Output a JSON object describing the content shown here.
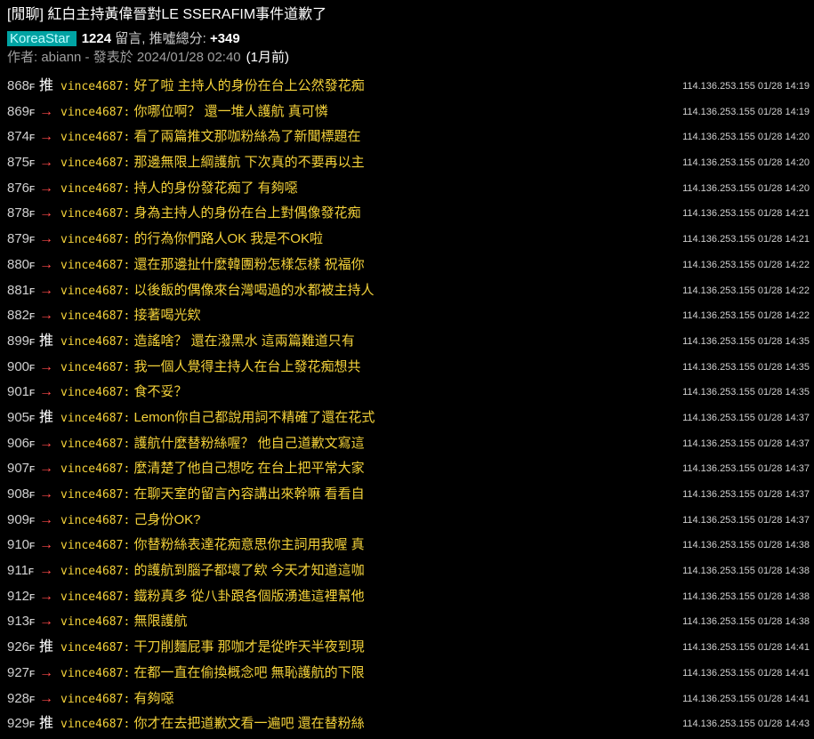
{
  "post": {
    "title": "[閒聊] 紅白主持黃偉晉對LE SSERAFIM事件道歉了",
    "board": " KoreaStar ",
    "comment_count": "1224",
    "comment_label": "留言, 推噓總分:",
    "score": "+349",
    "author_line": "作者: abiann - 發表於 2024/01/28 02:40",
    "ago": "(1月前)"
  },
  "colors": {
    "background": "#000000",
    "push_text": "#f4d23a",
    "arrow": "#ff4a4a",
    "board_tag_bg": "#00a3a3"
  },
  "comments": [
    {
      "floor": "868",
      "floor_suffix": "F",
      "tag": "推",
      "type": "push",
      "user": "vince4687",
      "text": "好了啦 主持人的身份在台上公然發花痴",
      "ipdate": "114.136.253.155 01/28 14:19"
    },
    {
      "floor": "869",
      "floor_suffix": "F",
      "tag": "→",
      "type": "arrow",
      "user": "vince4687",
      "text": "你哪位啊？ 還一堆人護航 真可憐",
      "ipdate": "114.136.253.155 01/28 14:19"
    },
    {
      "floor": "874",
      "floor_suffix": "F",
      "tag": "→",
      "type": "arrow",
      "user": "vince4687",
      "text": "看了兩篇推文那咖粉絲為了新聞標題在",
      "ipdate": "114.136.253.155 01/28 14:20"
    },
    {
      "floor": "875",
      "floor_suffix": "F",
      "tag": "→",
      "type": "arrow",
      "user": "vince4687",
      "text": "那邊無限上綱護航 下次真的不要再以主",
      "ipdate": "114.136.253.155 01/28 14:20"
    },
    {
      "floor": "876",
      "floor_suffix": "F",
      "tag": "→",
      "type": "arrow",
      "user": "vince4687",
      "text": "持人的身份發花痴了 有夠噁",
      "ipdate": "114.136.253.155 01/28 14:20"
    },
    {
      "floor": "878",
      "floor_suffix": "F",
      "tag": "→",
      "type": "arrow",
      "user": "vince4687",
      "text": "身為主持人的身份在台上對偶像發花痴",
      "ipdate": "114.136.253.155 01/28 14:21"
    },
    {
      "floor": "879",
      "floor_suffix": "F",
      "tag": "→",
      "type": "arrow",
      "user": "vince4687",
      "text": "的行為你們路人OK 我是不OK啦",
      "ipdate": "114.136.253.155 01/28 14:21"
    },
    {
      "floor": "880",
      "floor_suffix": "F",
      "tag": "→",
      "type": "arrow",
      "user": "vince4687",
      "text": "還在那邊扯什麼韓團粉怎樣怎樣 祝福你",
      "ipdate": "114.136.253.155 01/28 14:22"
    },
    {
      "floor": "881",
      "floor_suffix": "F",
      "tag": "→",
      "type": "arrow",
      "user": "vince4687",
      "text": "以後飯的偶像來台灣喝過的水都被主持人",
      "ipdate": "114.136.253.155 01/28 14:22"
    },
    {
      "floor": "882",
      "floor_suffix": "F",
      "tag": "→",
      "type": "arrow",
      "user": "vince4687",
      "text": "接著喝光欸",
      "ipdate": "114.136.253.155 01/28 14:22"
    },
    {
      "floor": "899",
      "floor_suffix": "F",
      "tag": "推",
      "type": "push",
      "user": "vince4687",
      "text": "造謠啥？ 還在潑黑水 這兩篇難道只有",
      "ipdate": "114.136.253.155 01/28 14:35"
    },
    {
      "floor": "900",
      "floor_suffix": "F",
      "tag": "→",
      "type": "arrow",
      "user": "vince4687",
      "text": "我一個人覺得主持人在台上發花痴想共",
      "ipdate": "114.136.253.155 01/28 14:35"
    },
    {
      "floor": "901",
      "floor_suffix": "F",
      "tag": "→",
      "type": "arrow",
      "user": "vince4687",
      "text": "食不妥？",
      "ipdate": "114.136.253.155 01/28 14:35"
    },
    {
      "floor": "905",
      "floor_suffix": "F",
      "tag": "推",
      "type": "push",
      "user": "vince4687",
      "text": "Lemon你自己都說用詞不精確了還在花式",
      "ipdate": "114.136.253.155 01/28 14:37"
    },
    {
      "floor": "906",
      "floor_suffix": "F",
      "tag": "→",
      "type": "arrow",
      "user": "vince4687",
      "text": "護航什麼替粉絲喔？ 他自己道歉文寫這",
      "ipdate": "114.136.253.155 01/28 14:37"
    },
    {
      "floor": "907",
      "floor_suffix": "F",
      "tag": "→",
      "type": "arrow",
      "user": "vince4687",
      "text": "麼清楚了他自己想吃 在台上把平常大家",
      "ipdate": "114.136.253.155 01/28 14:37"
    },
    {
      "floor": "908",
      "floor_suffix": "F",
      "tag": "→",
      "type": "arrow",
      "user": "vince4687",
      "text": "在聊天室的留言內容講出來幹嘛 看看自",
      "ipdate": "114.136.253.155 01/28 14:37"
    },
    {
      "floor": "909",
      "floor_suffix": "F",
      "tag": "→",
      "type": "arrow",
      "user": "vince4687",
      "text": "己身份OK?",
      "ipdate": "114.136.253.155 01/28 14:37"
    },
    {
      "floor": "910",
      "floor_suffix": "F",
      "tag": "→",
      "type": "arrow",
      "user": "vince4687",
      "text": "你替粉絲表達花痴意思你主詞用我喔 真",
      "ipdate": "114.136.253.155 01/28 14:38"
    },
    {
      "floor": "911",
      "floor_suffix": "F",
      "tag": "→",
      "type": "arrow",
      "user": "vince4687",
      "text": "的護航到腦子都壞了欸 今天才知道這咖",
      "ipdate": "114.136.253.155 01/28 14:38"
    },
    {
      "floor": "912",
      "floor_suffix": "F",
      "tag": "→",
      "type": "arrow",
      "user": "vince4687",
      "text": "鐵粉真多 從八卦跟各個版湧進這裡幫他",
      "ipdate": "114.136.253.155 01/28 14:38"
    },
    {
      "floor": "913",
      "floor_suffix": "F",
      "tag": "→",
      "type": "arrow",
      "user": "vince4687",
      "text": "無限護航",
      "ipdate": "114.136.253.155 01/28 14:38"
    },
    {
      "floor": "926",
      "floor_suffix": "F",
      "tag": "推",
      "type": "push",
      "user": "vince4687",
      "text": "干刀削麵屁事 那咖才是從昨天半夜到現",
      "ipdate": "114.136.253.155 01/28 14:41"
    },
    {
      "floor": "927",
      "floor_suffix": "F",
      "tag": "→",
      "type": "arrow",
      "user": "vince4687",
      "text": "在都一直在偷換概念吧 無恥護航的下限",
      "ipdate": "114.136.253.155 01/28 14:41"
    },
    {
      "floor": "928",
      "floor_suffix": "F",
      "tag": "→",
      "type": "arrow",
      "user": "vince4687",
      "text": "有夠噁",
      "ipdate": "114.136.253.155 01/28 14:41"
    },
    {
      "floor": "929",
      "floor_suffix": "F",
      "tag": "推",
      "type": "push",
      "user": "vince4687",
      "text": "你才在去把道歉文看一遍吧 還在替粉絲",
      "ipdate": "114.136.253.155 01/28 14:43"
    }
  ]
}
